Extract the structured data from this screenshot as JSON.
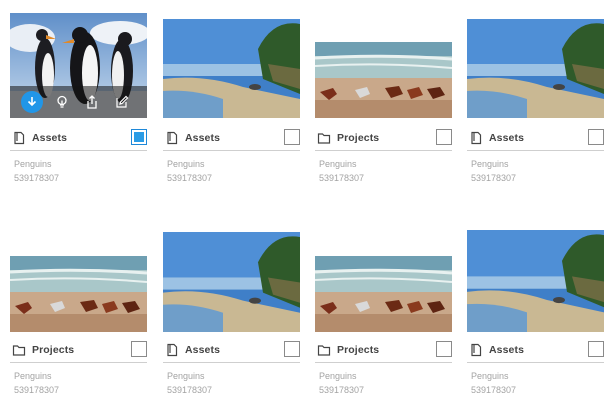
{
  "cards": [
    {
      "type_label": "Assets",
      "type_icon": "document-icon",
      "image": "penguins-icon",
      "name": "Penguins",
      "id": "539178307",
      "selected": true
    },
    {
      "type_label": "Assets",
      "type_icon": "document-icon",
      "image": "beach-image",
      "name": "Penguins",
      "id": "539178307",
      "selected": false
    },
    {
      "type_label": "Projects",
      "type_icon": "folder-icon",
      "image": "horses-image",
      "name": "Penguins",
      "id": "539178307",
      "selected": false
    },
    {
      "type_label": "Assets",
      "type_icon": "document-icon",
      "image": "beach-image",
      "name": "Penguins",
      "id": "539178307",
      "selected": false
    },
    {
      "type_label": "Projects",
      "type_icon": "folder-icon",
      "image": "horses-image",
      "name": "Penguins",
      "id": "539178307",
      "selected": false
    },
    {
      "type_label": "Assets",
      "type_icon": "document-icon",
      "image": "beach-image",
      "name": "Penguins",
      "id": "539178307",
      "selected": false
    },
    {
      "type_label": "Projects",
      "type_icon": "folder-icon",
      "image": "horses-image",
      "name": "Penguins",
      "id": "539178307",
      "selected": false
    },
    {
      "type_label": "Assets",
      "type_icon": "document-icon",
      "image": "beach-image",
      "name": "Penguins",
      "id": "539178307",
      "selected": false
    }
  ],
  "hover_actions": [
    "download-icon",
    "bulb-icon",
    "share-icon",
    "edit-icon"
  ],
  "colors": {
    "accent": "#2196e8",
    "checkbox_checked": "#2a9ce6",
    "text_muted": "#a3a3a3"
  }
}
